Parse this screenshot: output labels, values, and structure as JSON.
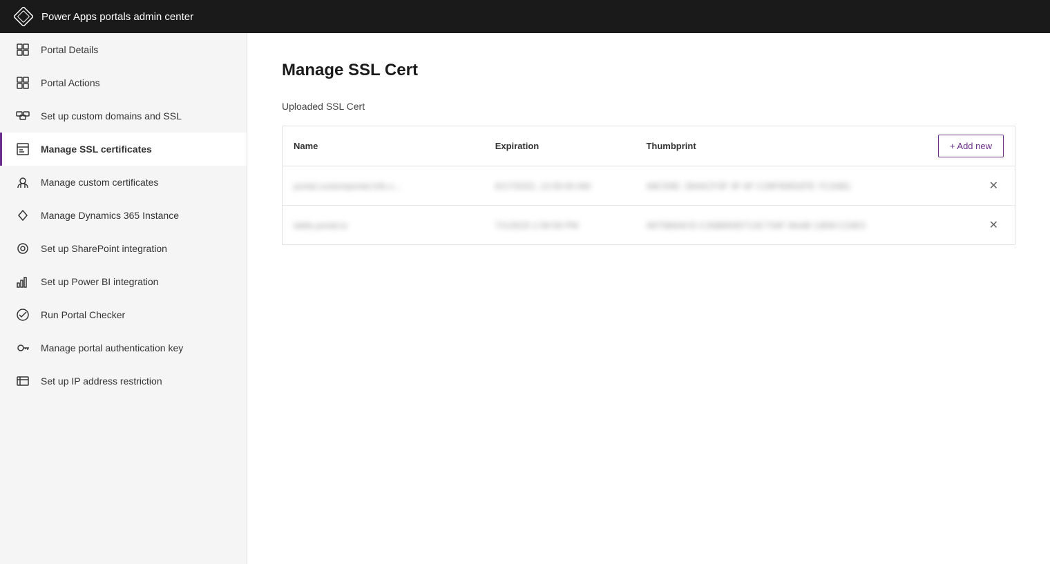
{
  "header": {
    "title": "Power Apps portals admin center"
  },
  "sidebar": {
    "items": [
      {
        "id": "portal-details",
        "label": "Portal Details",
        "icon": "grid-icon",
        "active": false
      },
      {
        "id": "portal-actions",
        "label": "Portal Actions",
        "icon": "actions-icon",
        "active": false
      },
      {
        "id": "custom-domains",
        "label": "Set up custom domains and SSL",
        "icon": "domains-icon",
        "active": false
      },
      {
        "id": "manage-ssl",
        "label": "Manage SSL certificates",
        "icon": "cert-icon",
        "active": true
      },
      {
        "id": "custom-certs",
        "label": "Manage custom certificates",
        "icon": "custom-cert-icon",
        "active": false
      },
      {
        "id": "dynamics-instance",
        "label": "Manage Dynamics 365 Instance",
        "icon": "dynamics-icon",
        "active": false
      },
      {
        "id": "sharepoint",
        "label": "Set up SharePoint integration",
        "icon": "sharepoint-icon",
        "active": false
      },
      {
        "id": "powerbi",
        "label": "Set up Power BI integration",
        "icon": "powerbi-icon",
        "active": false
      },
      {
        "id": "portal-checker",
        "label": "Run Portal Checker",
        "icon": "checker-icon",
        "active": false
      },
      {
        "id": "auth-key",
        "label": "Manage portal authentication key",
        "icon": "key-icon",
        "active": false
      },
      {
        "id": "ip-restriction",
        "label": "Set up IP address restriction",
        "icon": "ip-icon",
        "active": false
      }
    ]
  },
  "content": {
    "title": "Manage SSL Cert",
    "section_label": "Uploaded SSL Cert",
    "table": {
      "columns": [
        "Name",
        "Expiration",
        "Thumbprint"
      ],
      "add_button": "+ Add new",
      "rows": [
        {
          "name": "portal.customportal.info.c...",
          "expiration": "6/17/2022, 12:00:00 AM",
          "thumbprint": "A8C93E: 394ACF3F 3F 6F C28F90832FE 7C2AB1"
        },
        {
          "name": "table.portal.io",
          "expiration": "7/1/2023 1:59:59 PM",
          "thumbprint": "4975B6A0:E-C26B893D713C734F 9AAB 13EB:C24E3"
        }
      ]
    }
  }
}
